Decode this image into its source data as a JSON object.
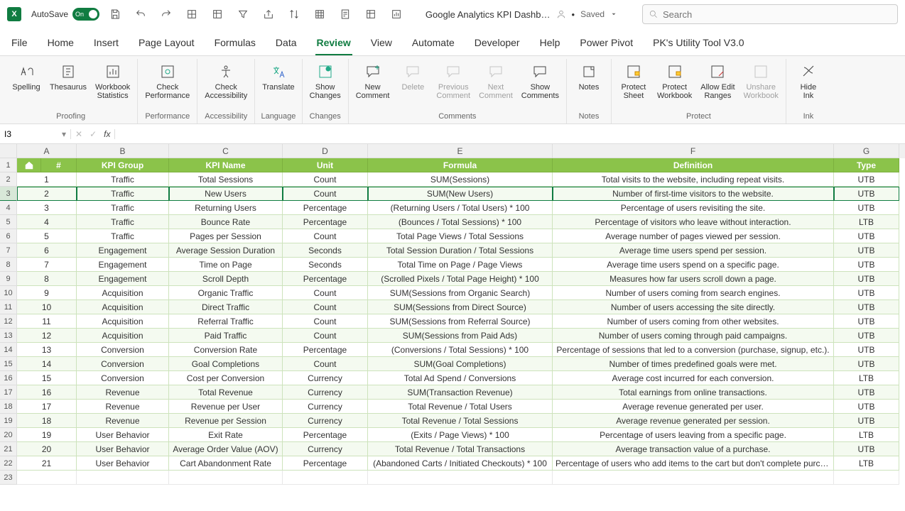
{
  "titlebar": {
    "autosave_label": "AutoSave",
    "toggle_text": "On",
    "doc_name": "Google Analytics KPI Dashb…",
    "saved_label": "Saved",
    "search_placeholder": "Search"
  },
  "tabs": [
    "File",
    "Home",
    "Insert",
    "Page Layout",
    "Formulas",
    "Data",
    "Review",
    "View",
    "Automate",
    "Developer",
    "Help",
    "Power Pivot",
    "PK's Utility Tool V3.0"
  ],
  "active_tab": "Review",
  "ribbon_groups": {
    "proofing": {
      "name": "Proofing",
      "spelling": "Spelling",
      "thesaurus": "Thesaurus",
      "workbook_stats": "Workbook\nStatistics"
    },
    "performance": {
      "name": "Performance",
      "check_perf": "Check\nPerformance"
    },
    "accessibility": {
      "name": "Accessibility",
      "check_acc": "Check\nAccessibility"
    },
    "language": {
      "name": "Language",
      "translate": "Translate"
    },
    "changes": {
      "name": "Changes",
      "show_changes": "Show\nChanges"
    },
    "comments": {
      "name": "Comments",
      "new": "New\nComment",
      "delete": "Delete",
      "previous": "Previous\nComment",
      "next": "Next\nComment",
      "show": "Show\nComments"
    },
    "notes": {
      "name": "Notes",
      "notes": "Notes"
    },
    "protect": {
      "name": "Protect",
      "sheet": "Protect\nSheet",
      "workbook": "Protect\nWorkbook",
      "allow_edit": "Allow Edit\nRanges",
      "unshare": "Unshare\nWorkbook"
    },
    "ink": {
      "name": "Ink",
      "hide_ink": "Hide\nInk"
    }
  },
  "namebox": "I3",
  "columns": [
    "A",
    "B",
    "C",
    "D",
    "E",
    "F",
    "G"
  ],
  "table_header": {
    "num": "#",
    "group": "KPI Group",
    "name": "KPI Name",
    "unit": "Unit",
    "formula": "Formula",
    "definition": "Definition",
    "type": "Type"
  },
  "rows": [
    {
      "n": "1",
      "group": "Traffic",
      "name": "Total Sessions",
      "unit": "Count",
      "formula": "SUM(Sessions)",
      "def": "Total visits to the website, including repeat visits.",
      "type": "UTB"
    },
    {
      "n": "2",
      "group": "Traffic",
      "name": "New Users",
      "unit": "Count",
      "formula": "SUM(New Users)",
      "def": "Number of first-time visitors to the website.",
      "type": "UTB"
    },
    {
      "n": "3",
      "group": "Traffic",
      "name": "Returning Users",
      "unit": "Percentage",
      "formula": "(Returning Users / Total Users) * 100",
      "def": "Percentage of users revisiting the site.",
      "type": "UTB"
    },
    {
      "n": "4",
      "group": "Traffic",
      "name": "Bounce Rate",
      "unit": "Percentage",
      "formula": "(Bounces / Total Sessions) * 100",
      "def": "Percentage of visitors who leave without interaction.",
      "type": "LTB"
    },
    {
      "n": "5",
      "group": "Traffic",
      "name": "Pages per Session",
      "unit": "Count",
      "formula": "Total Page Views / Total Sessions",
      "def": "Average number of pages viewed per session.",
      "type": "UTB"
    },
    {
      "n": "6",
      "group": "Engagement",
      "name": "Average Session Duration",
      "unit": "Seconds",
      "formula": "Total Session Duration / Total Sessions",
      "def": "Average time users spend per session.",
      "type": "UTB"
    },
    {
      "n": "7",
      "group": "Engagement",
      "name": "Time on Page",
      "unit": "Seconds",
      "formula": "Total Time on Page / Page Views",
      "def": "Average time users spend on a specific page.",
      "type": "UTB"
    },
    {
      "n": "8",
      "group": "Engagement",
      "name": "Scroll Depth",
      "unit": "Percentage",
      "formula": "(Scrolled Pixels / Total Page Height) * 100",
      "def": "Measures how far users scroll down a page.",
      "type": "UTB"
    },
    {
      "n": "9",
      "group": "Acquisition",
      "name": "Organic Traffic",
      "unit": "Count",
      "formula": "SUM(Sessions from Organic Search)",
      "def": "Number of users coming from search engines.",
      "type": "UTB"
    },
    {
      "n": "10",
      "group": "Acquisition",
      "name": "Direct Traffic",
      "unit": "Count",
      "formula": "SUM(Sessions from Direct Source)",
      "def": "Number of users accessing the site directly.",
      "type": "UTB"
    },
    {
      "n": "11",
      "group": "Acquisition",
      "name": "Referral Traffic",
      "unit": "Count",
      "formula": "SUM(Sessions from Referral Source)",
      "def": "Number of users coming from other websites.",
      "type": "UTB"
    },
    {
      "n": "12",
      "group": "Acquisition",
      "name": "Paid Traffic",
      "unit": "Count",
      "formula": "SUM(Sessions from Paid Ads)",
      "def": "Number of users coming through paid campaigns.",
      "type": "UTB"
    },
    {
      "n": "13",
      "group": "Conversion",
      "name": "Conversion Rate",
      "unit": "Percentage",
      "formula": "(Conversions / Total Sessions) * 100",
      "def": "Percentage of sessions that led to a conversion (purchase, signup, etc.).",
      "type": "UTB"
    },
    {
      "n": "14",
      "group": "Conversion",
      "name": "Goal Completions",
      "unit": "Count",
      "formula": "SUM(Goal Completions)",
      "def": "Number of times predefined goals were met.",
      "type": "UTB"
    },
    {
      "n": "15",
      "group": "Conversion",
      "name": "Cost per Conversion",
      "unit": "Currency",
      "formula": "Total Ad Spend / Conversions",
      "def": "Average cost incurred for each conversion.",
      "type": "LTB"
    },
    {
      "n": "16",
      "group": "Revenue",
      "name": "Total Revenue",
      "unit": "Currency",
      "formula": "SUM(Transaction Revenue)",
      "def": "Total earnings from online transactions.",
      "type": "UTB"
    },
    {
      "n": "17",
      "group": "Revenue",
      "name": "Revenue per User",
      "unit": "Currency",
      "formula": "Total Revenue / Total Users",
      "def": "Average revenue generated per user.",
      "type": "UTB"
    },
    {
      "n": "18",
      "group": "Revenue",
      "name": "Revenue per Session",
      "unit": "Currency",
      "formula": "Total Revenue / Total Sessions",
      "def": "Average revenue generated per session.",
      "type": "UTB"
    },
    {
      "n": "19",
      "group": "User Behavior",
      "name": "Exit Rate",
      "unit": "Percentage",
      "formula": "(Exits / Page Views) * 100",
      "def": "Percentage of users leaving from a specific page.",
      "type": "LTB"
    },
    {
      "n": "20",
      "group": "User Behavior",
      "name": "Average Order Value (AOV)",
      "unit": "Currency",
      "formula": "Total Revenue / Total Transactions",
      "def": "Average transaction value of a purchase.",
      "type": "UTB"
    },
    {
      "n": "21",
      "group": "User Behavior",
      "name": "Cart Abandonment Rate",
      "unit": "Percentage",
      "formula": "(Abandoned Carts / Initiated Checkouts) * 100",
      "def": "Percentage of users who add items to the cart but don't complete purchase.",
      "type": "LTB"
    }
  ],
  "selected_row_index": 1
}
